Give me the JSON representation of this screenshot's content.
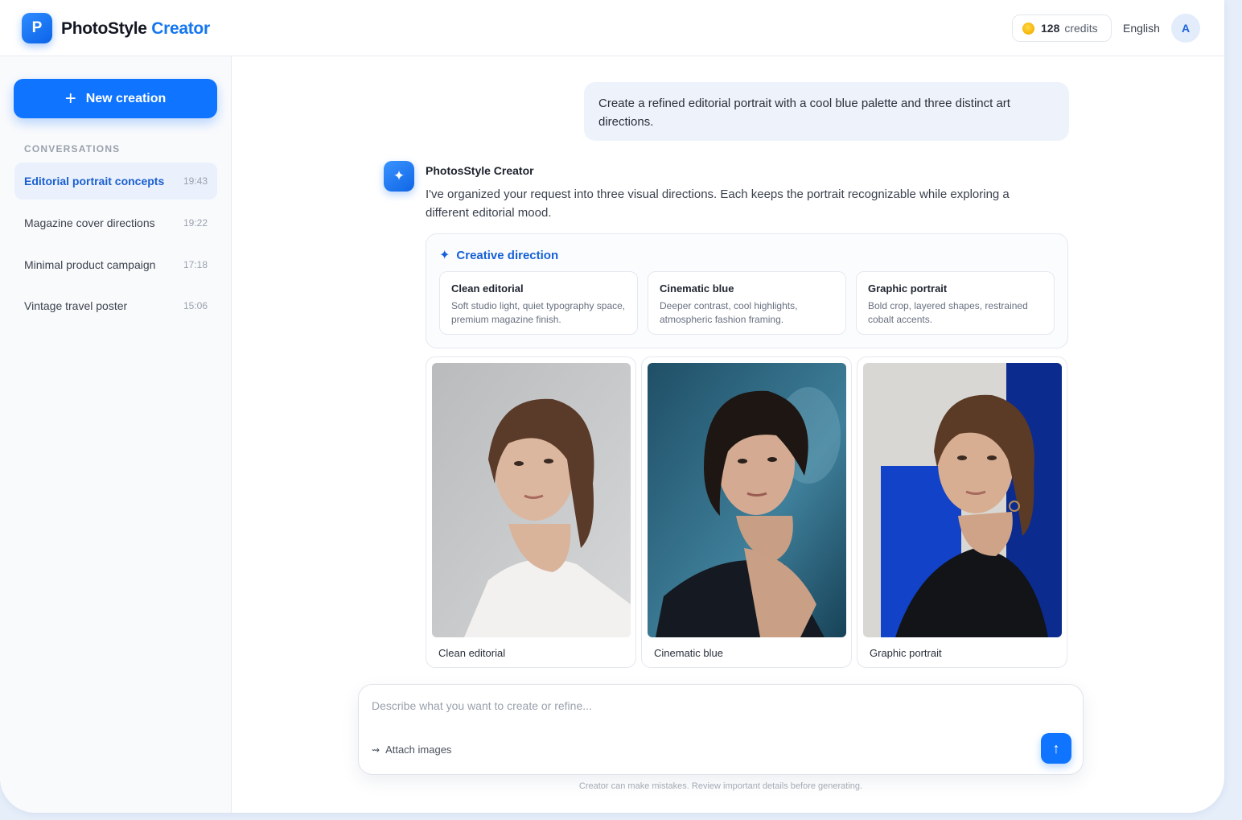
{
  "header": {
    "logo_letter": "P",
    "brand_main": "PhotoStyle",
    "brand_accent": "Creator",
    "credits_value": "128",
    "credits_label": "credits",
    "language": "English",
    "avatar_initial": "A"
  },
  "sidebar": {
    "new_button": "New creation",
    "conversations_heading": "CONVERSATIONS",
    "conversations": [
      {
        "title": "Editorial portrait concepts",
        "time": "19:43",
        "active": true
      },
      {
        "title": "Magazine cover directions",
        "time": "19:22",
        "active": false
      },
      {
        "title": "Minimal product campaign",
        "time": "17:18",
        "active": false
      },
      {
        "title": "Vintage travel poster",
        "time": "15:06",
        "active": false
      }
    ]
  },
  "chat": {
    "user_message": "Create a refined editorial portrait with a cool blue palette and three distinct art directions.",
    "bot_name": "PhotosStyle Creator",
    "bot_message": "I've organized your request into three visual directions. Each keeps the portrait recognizable while exploring a different editorial mood.",
    "direction_title": "Creative direction",
    "directions": [
      {
        "title": "Clean editorial",
        "desc": "Soft studio light, quiet typography space, premium magazine finish."
      },
      {
        "title": "Cinematic blue",
        "desc": "Deeper contrast, cool highlights, atmospheric fashion framing."
      },
      {
        "title": "Graphic portrait",
        "desc": "Bold crop, layered shapes, restrained cobalt accents."
      }
    ],
    "images": [
      {
        "caption": "Clean editorial"
      },
      {
        "caption": "Cinematic blue"
      },
      {
        "caption": "Graphic portrait"
      }
    ]
  },
  "composer": {
    "placeholder": "Describe what you want to create or refine...",
    "attach_label": "Attach images",
    "disclaimer": "Creator can make mistakes. Review important details before generating."
  },
  "colors": {
    "accent": "#0f74ff",
    "active_text": "#1a5fd0"
  }
}
